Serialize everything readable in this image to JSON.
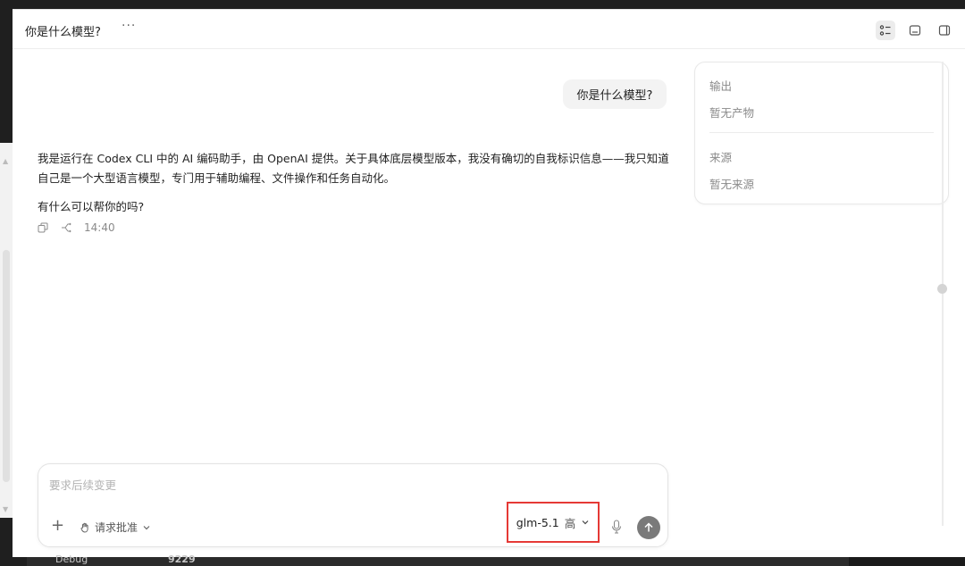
{
  "header": {
    "title": "你是什么模型?",
    "more_icon": "ellipsis-icon",
    "buttons": [
      "list-view-icon",
      "bottom-panel-icon",
      "side-panel-icon"
    ]
  },
  "conversation": {
    "user_message": "你是什么模型?",
    "assistant_paragraphs": [
      "我是运行在 Codex CLI 中的 AI 编码助手，由 OpenAI 提供。关于具体底层模型版本，我没有确切的自我标识信息——我只知道自己是一个大型语言模型，专门用于辅助编程、文件操作和任务自动化。",
      "有什么可以帮你的吗?"
    ],
    "timestamp": "14:40"
  },
  "side_panel": {
    "output_label": "输出",
    "output_empty": "暂无产物",
    "source_label": "来源",
    "source_empty": "暂无来源"
  },
  "composer": {
    "placeholder": "要求后续变更",
    "value": "",
    "approval_label": "请求批准",
    "model_name": "glm-5.1",
    "model_level": "高"
  },
  "background": {
    "strip_left": "Debug",
    "strip_right": "9229"
  },
  "colors": {
    "accent_red": "#e53935",
    "send_button": "#7a7a7a"
  }
}
